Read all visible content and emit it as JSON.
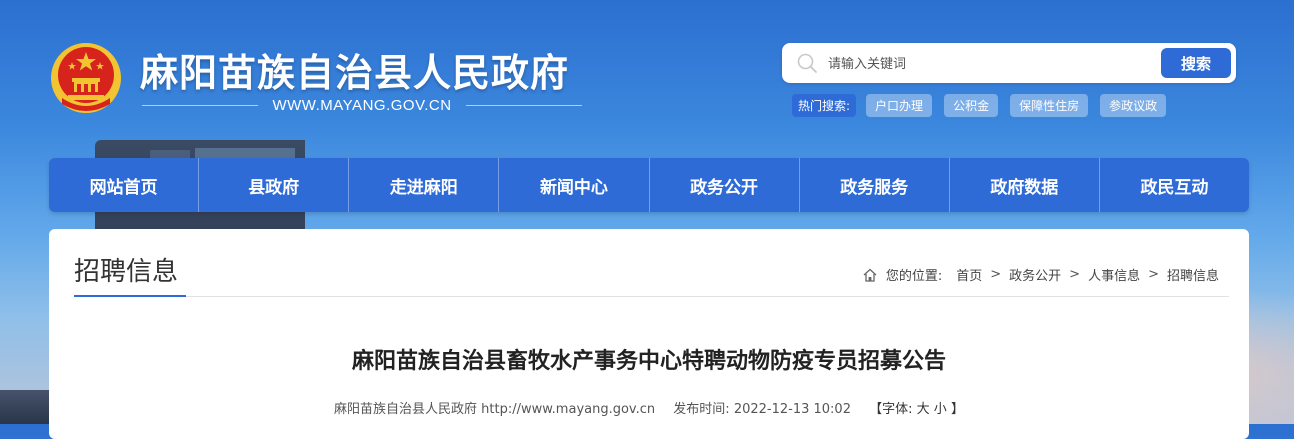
{
  "header": {
    "site_title": "麻阳苗族自治县人民政府",
    "site_url": "WWW.MAYANG.GOV.CN",
    "search": {
      "placeholder": "请输入关键词",
      "button_label": "搜索"
    },
    "hot_search": {
      "label": "热门搜索:",
      "tags": [
        "户口办理",
        "公积金",
        "保障性住房",
        "参政议政"
      ]
    }
  },
  "nav": {
    "items": [
      "网站首页",
      "县政府",
      "走进麻阳",
      "新闻中心",
      "政务公开",
      "政务服务",
      "政府数据",
      "政民互动"
    ]
  },
  "panel": {
    "title": "招聘信息",
    "breadcrumb": {
      "label": "您的位置:",
      "items": [
        "首页",
        "政务公开",
        "人事信息",
        "招聘信息"
      ],
      "separator": ">"
    }
  },
  "article": {
    "title": "麻阳苗族自治县畜牧水产事务中心特聘动物防疫专员招募公告",
    "source": "麻阳苗族自治县人民政府 http://www.mayang.gov.cn",
    "publish_label": "发布时间:",
    "publish_time": "2022-12-13 10:02",
    "font_label": "【字体:",
    "font_large": "大",
    "font_small": "小",
    "font_close": "】"
  },
  "colors": {
    "accent": "#2f6bd6",
    "emblem_red": "#d6231c",
    "emblem_gold": "#f3c431"
  },
  "icons": {
    "emblem": "national-emblem-icon",
    "search": "search-icon",
    "home": "home-icon"
  }
}
